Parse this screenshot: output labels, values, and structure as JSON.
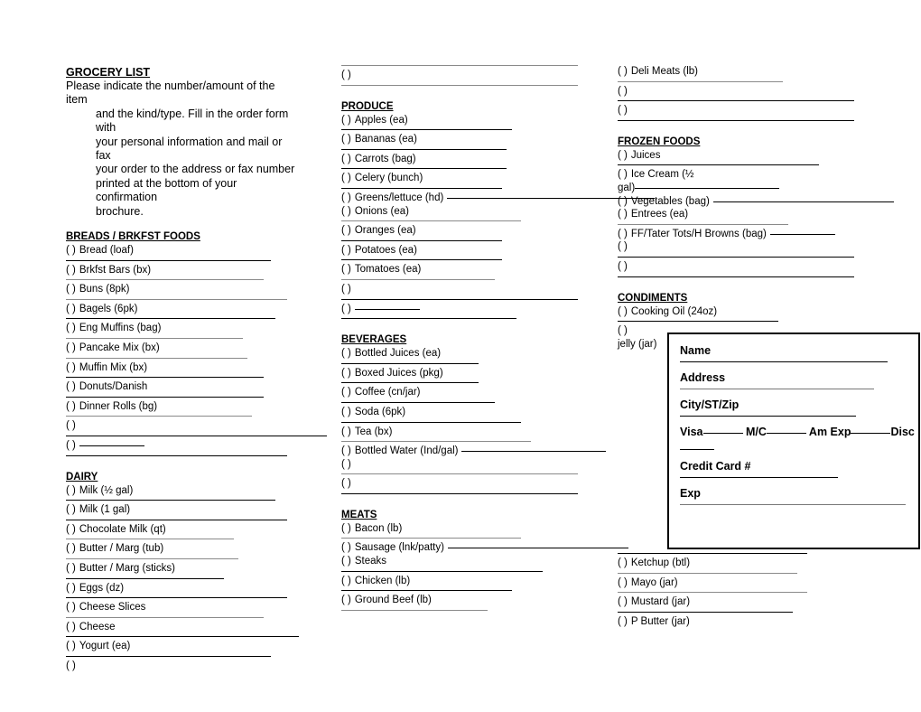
{
  "document": {
    "title": "GROCERY LIST",
    "instructions_line1": "Please indicate the number/amount of the item",
    "instructions_line2": "and the kind/type. Fill in the order form with",
    "instructions_line3": "your personal information and mail or fax",
    "instructions_line4": "your order to the address or fax number",
    "instructions_line5": "printed at the bottom of your confirmation",
    "instructions_line6": "brochure.",
    "checkbox_mark": "(    )"
  },
  "sections": {
    "breads": {
      "heading": "BREADS / BRKFST FOODS",
      "items": [
        "Bread (loaf)",
        "Brkfst Bars (bx)",
        "Buns (8pk)",
        "Bagels (6pk)",
        "Eng Muffins (bag)",
        "Pancake Mix (bx)",
        "Muffin Mix (bx)",
        "Donuts/Danish",
        "Dinner Rolls (bg)",
        "",
        ""
      ]
    },
    "dairy": {
      "heading": "DAIRY",
      "items": [
        "Milk (½ gal)",
        "Milk (1 gal)",
        "Chocolate Milk (qt)",
        "Butter / Marg (tub)",
        "Butter / Marg (sticks)",
        "Eggs (dz)",
        "Cheese Slices",
        "Cheese",
        "Yogurt (ea)",
        ""
      ]
    },
    "produce": {
      "heading": "PRODUCE",
      "items": [
        "Apples (ea)",
        "Bananas (ea)",
        "Carrots (bag)",
        "Celery (bunch)",
        "Greens/lettuce (hd)",
        "Onions (ea)",
        "Oranges (ea)",
        "Potatoes (ea)",
        "Tomatoes (ea)",
        "",
        ""
      ]
    },
    "beverages": {
      "heading": "BEVERAGES",
      "items": [
        "Bottled Juices (ea)",
        "Boxed Juices (pkg)",
        "Coffee (cn/jar)",
        "Soda (6pk)",
        "Tea (bx)",
        "Bottled Water (Ind/gal)",
        "",
        ""
      ]
    },
    "meats": {
      "heading": "MEATS",
      "items": [
        "Bacon (lb)",
        "Sausage (lnk/patty)",
        "Steaks",
        "Chicken (lb)",
        "Ground Beef (lb)"
      ]
    },
    "deli": {
      "items": [
        "Deli Meats (lb)",
        "",
        ""
      ]
    },
    "frozen": {
      "heading": "FROZEN FOODS",
      "items": [
        "Juices",
        "Ice Cream (½",
        "gal)",
        "Vegetables (bag)",
        "Entrees (ea)",
        "FF/Tater Tots/H Browns (bag)",
        "",
        ""
      ]
    },
    "condiments": {
      "heading": "CONDIMENTS",
      "items": [
        "Cooking Oil (24oz)",
        ""
      ],
      "jelly_note": "jelly (jar)",
      "items_lower": [
        "Ketchup (btl)",
        "Mayo (jar)",
        "Mustard (jar)",
        "P Butter (jar)"
      ]
    }
  },
  "order_form": {
    "name_label": "Name",
    "address_label": "Address",
    "city_label": "City/ST/Zip",
    "card_visa": "Visa",
    "card_mc": "M/C",
    "card_amex": "Am Exp",
    "card_disc": "Disc",
    "credit_card_label": "Credit Card #",
    "exp_label": "Exp"
  }
}
